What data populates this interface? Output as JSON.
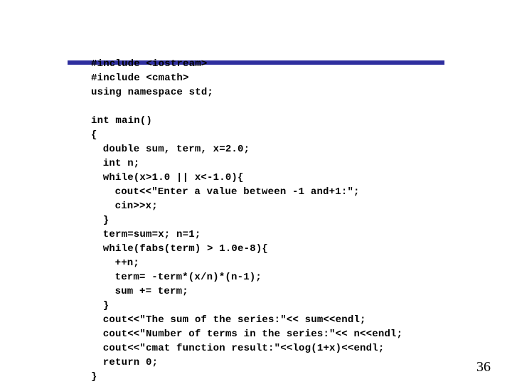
{
  "code": {
    "l01": "#include <iostream>",
    "l02": "#include <cmath>",
    "l03": "using namespace std;",
    "l04": "",
    "l05": "int main()",
    "l06": "{",
    "l07": "double sum, term, x=2.0;",
    "l08": "int n;",
    "l09": "while(x>1.0 || x<-1.0){",
    "l10": "cout<<\"Enter a value between -1 and+1:\";",
    "l11": "cin>>x;",
    "l12": "}",
    "l13": "term=sum=x; n=1;",
    "l14": "while(fabs(term) > 1.0e-8){",
    "l15": "++n;",
    "l16": "term= -term*(x/n)*(n-1);",
    "l17": "sum += term;",
    "l18": "}",
    "l19": "cout<<\"The sum of the series:\"<< sum<<endl;",
    "l20": "cout<<\"Number of terms in the series:\"<< n<<endl;",
    "l21": "cout<<\"cmat function result:\"<<log(1+x)<<endl;",
    "l22": "return 0;",
    "l23": "}"
  },
  "page_number": "36",
  "colors": {
    "rule": "#2e2e9e"
  }
}
